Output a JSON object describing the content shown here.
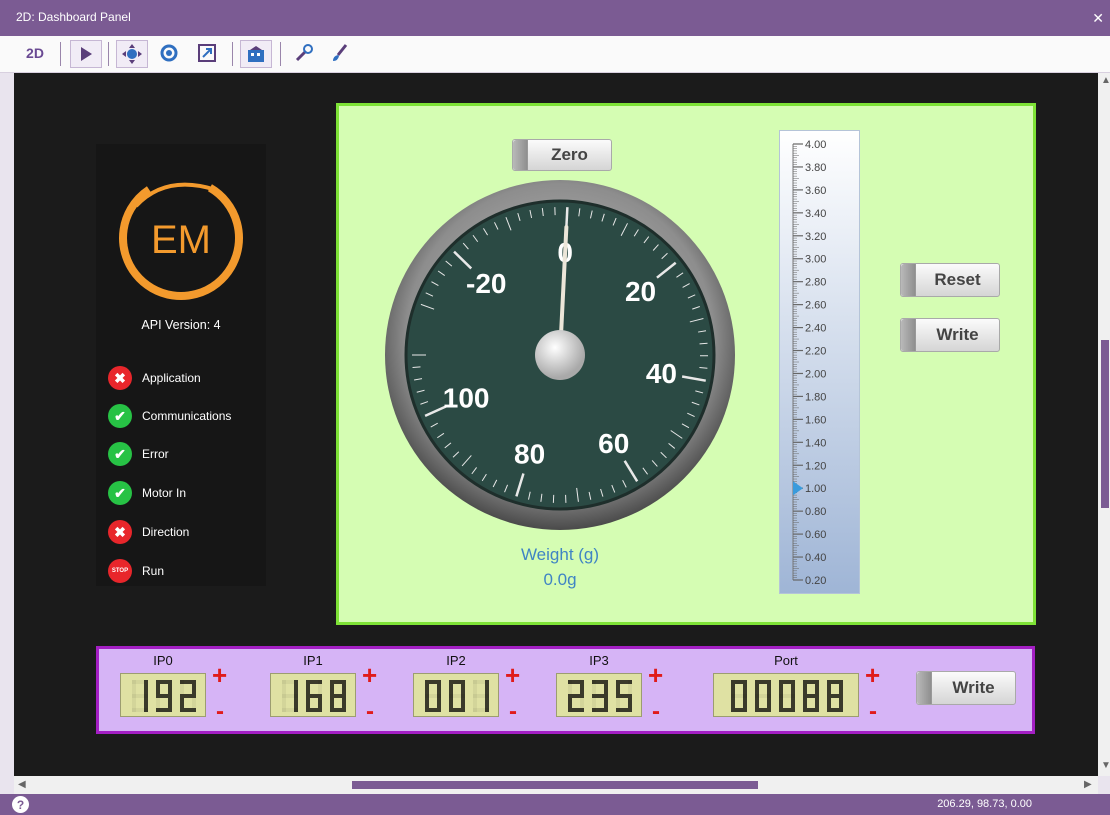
{
  "window": {
    "title": "2D: Dashboard Panel"
  },
  "toolbar": {
    "label_2d": "2D"
  },
  "status_bar": {
    "coords": "206.29, 98.73, 0.00"
  },
  "info_panel": {
    "logo_text": "EM",
    "api_version": "API Version: 4",
    "statuses": [
      {
        "label": "Application",
        "state": "error"
      },
      {
        "label": "Communications",
        "state": "ok"
      },
      {
        "label": "Error",
        "state": "ok"
      },
      {
        "label": "Motor In",
        "state": "ok"
      },
      {
        "label": "Direction",
        "state": "error"
      },
      {
        "label": "Run",
        "state": "stop"
      }
    ],
    "stop_text": "STOP"
  },
  "controls": {
    "zero_label": "Zero",
    "reset_label": "Reset",
    "write_label": "Write"
  },
  "gauge": {
    "label": "Weight (g)",
    "value_text": "0.0g",
    "value": 0,
    "min": -30,
    "max": 110,
    "major_labels": [
      "-20",
      "0",
      "20",
      "40",
      "60",
      "80",
      "100"
    ]
  },
  "slider": {
    "min": 0.2,
    "max": 4.0,
    "value": 1.0,
    "tick_labels": [
      "4.00",
      "3.80",
      "3.60",
      "3.40",
      "3.20",
      "3.00",
      "2.80",
      "2.60",
      "2.40",
      "2.20",
      "2.00",
      "1.80",
      "1.60",
      "1.40",
      "1.20",
      "1.00",
      "0.80",
      "0.60",
      "0.40",
      "0.20"
    ]
  },
  "network": {
    "fields": [
      {
        "label": "IP0",
        "value": "192"
      },
      {
        "label": "IP1",
        "value": "168"
      },
      {
        "label": "IP2",
        "value": "001"
      },
      {
        "label": "IP3",
        "value": "235"
      },
      {
        "label": "Port",
        "value": "00088"
      }
    ],
    "plus": "+",
    "minus": "-",
    "write_label": "Write"
  },
  "colors": {
    "window_purple": "#7b5b93",
    "panel_green": "#d5fdb3",
    "panel_purple": "#d6b4f6",
    "accent_orange": "#f39a2d",
    "gauge_face": "#2b4a44"
  }
}
